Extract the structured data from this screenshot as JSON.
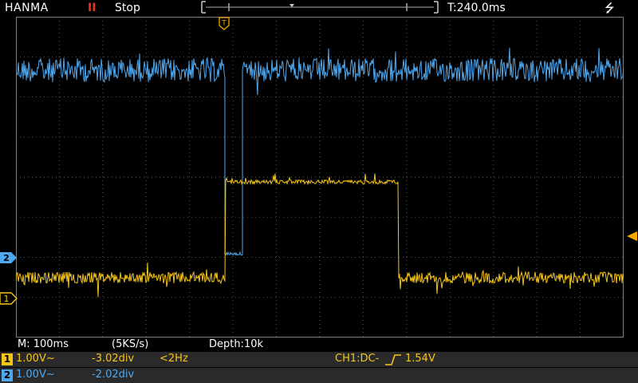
{
  "header": {
    "brand": "HANMA",
    "run_icon": "II",
    "run_state": "Stop",
    "time_position": "T:240.0ms",
    "usb_icon": "usb-icon"
  },
  "trigger_marker_label": "T",
  "status": {
    "timebase": "M: 100ms",
    "sample_rate": "(5KS/s)",
    "depth": "Depth:10k"
  },
  "channels": [
    {
      "id": "1",
      "scale": "1.00V~",
      "offset": "-3.02div",
      "freq": "<2Hz",
      "trigger": "CH1:DC-",
      "trigger_level": "1.54V",
      "color": "#f5c518"
    },
    {
      "id": "2",
      "scale": "1.00V~",
      "offset": "-2.02div",
      "color": "#4ea8ef"
    }
  ],
  "colors": {
    "ch1": "#f5c518",
    "ch2": "#4ea8ef",
    "grid": "#5a5a5a",
    "trigger_arrow": "#f5a800"
  }
}
